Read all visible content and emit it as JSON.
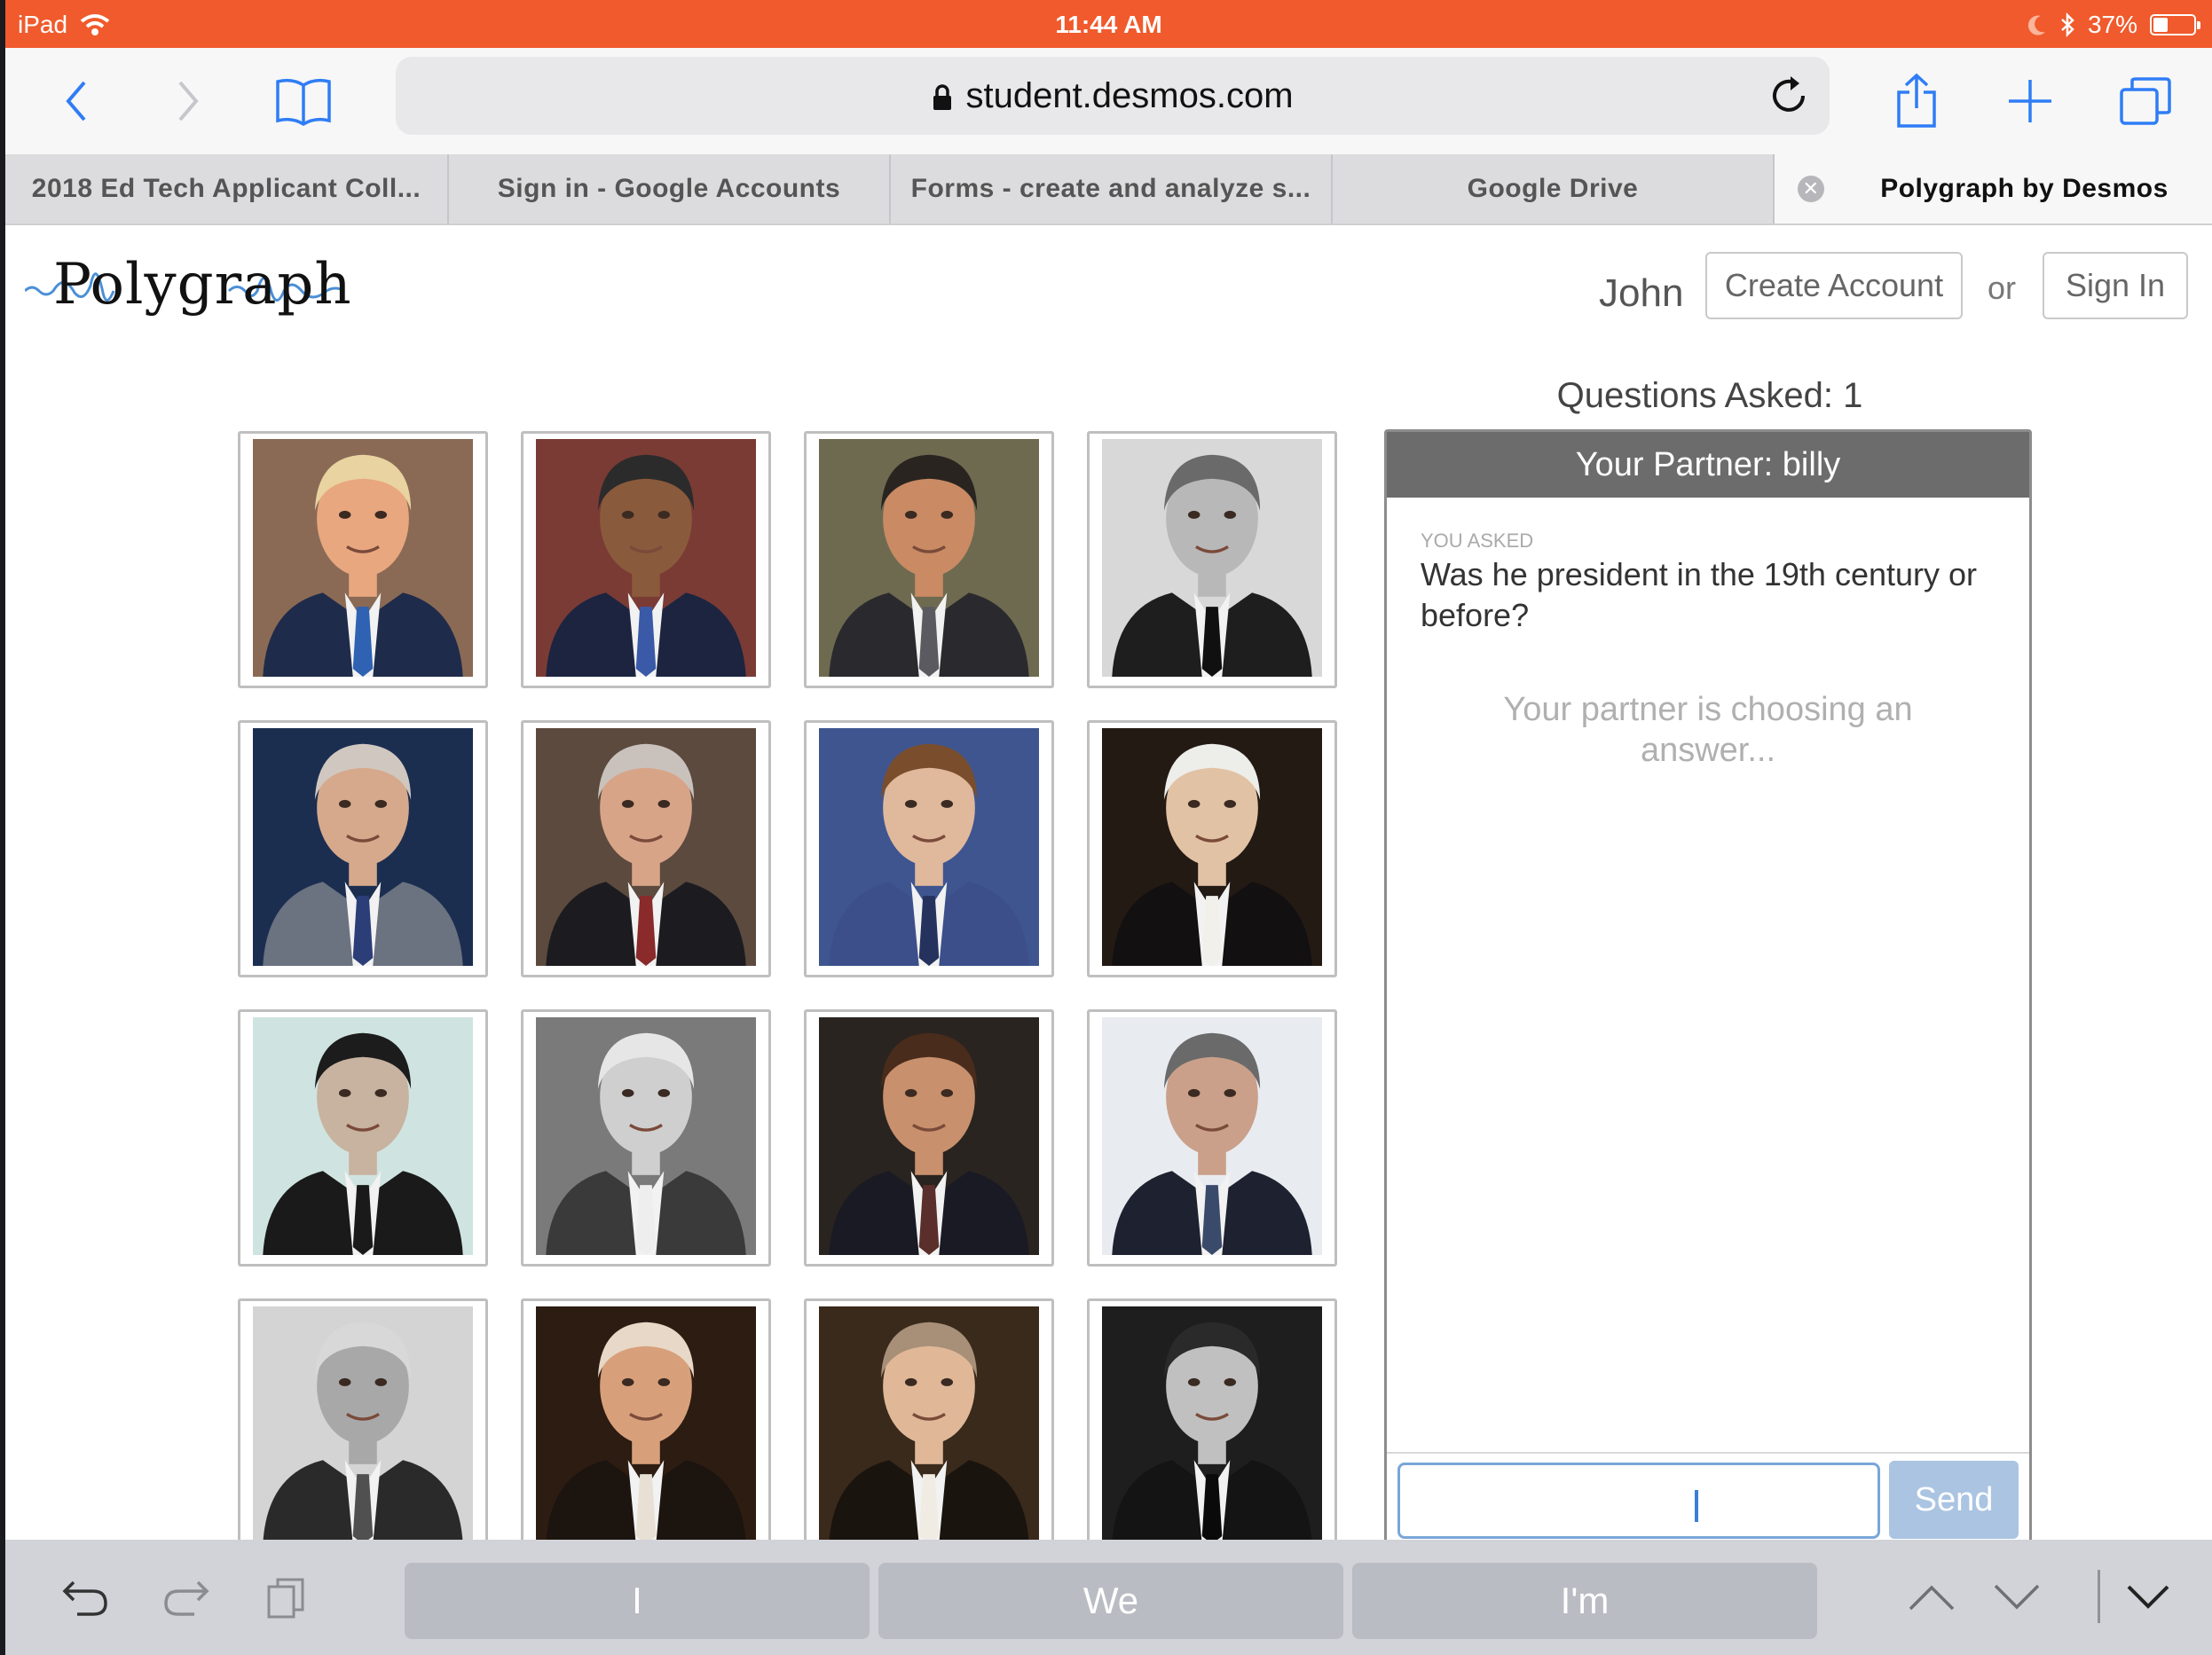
{
  "status_bar": {
    "device": "iPad",
    "time": "11:44 AM",
    "battery": "37%",
    "battery_level": 0.37
  },
  "browser": {
    "url": "student.desmos.com",
    "tabs": [
      {
        "title": "2018 Ed Tech Applicant Coll...",
        "active": false
      },
      {
        "title": "Sign in - Google Accounts",
        "active": false
      },
      {
        "title": "Forms - create and analyze s...",
        "active": false
      },
      {
        "title": "Google Drive",
        "active": false
      },
      {
        "title": "Polygraph by Desmos",
        "active": true
      }
    ]
  },
  "header": {
    "logo": "Polygraph",
    "user_name": "John",
    "create_account_label": "Create Account",
    "or_label": "or",
    "sign_in_label": "Sign In"
  },
  "game": {
    "questions_asked": "Questions Asked: 1",
    "partner_header": "Your Partner: billy",
    "you_asked_label": "YOU ASKED",
    "question": "Was he president in the 19th century or before?",
    "waiting": "Your partner is choosing an answer...",
    "input_value": "",
    "send_label": "Send",
    "cards": [
      {
        "name": "portrait-1",
        "bg": "#8a6a55",
        "skin": "#e8a77f",
        "hair": "#e9d3a0",
        "suit": "#1f2b4a",
        "tie": "#2f62b2"
      },
      {
        "name": "portrait-2",
        "bg": "#7a3b35",
        "skin": "#8a5a3c",
        "hair": "#2b2b2b",
        "suit": "#1c2440",
        "tie": "#3a5aa8"
      },
      {
        "name": "portrait-3",
        "bg": "#6e6a50",
        "skin": "#c98a64",
        "hair": "#2a2420",
        "suit": "#2a2a2e",
        "tie": "#5a5a60"
      },
      {
        "name": "portrait-4",
        "bg": "#d8d8d8",
        "skin": "#b8b8b8",
        "hair": "#6a6a6a",
        "suit": "#1e1e1e",
        "tie": "#101010"
      },
      {
        "name": "portrait-5",
        "bg": "#1c2e50",
        "skin": "#d6a98c",
        "hair": "#d0c8c0",
        "suit": "#6b7280",
        "tie": "#2c3e78"
      },
      {
        "name": "portrait-6",
        "bg": "#5c4a3e",
        "skin": "#d8a488",
        "hair": "#c9c2bc",
        "suit": "#1c1c20",
        "tie": "#8a2a2a"
      },
      {
        "name": "portrait-7",
        "bg": "#3e5590",
        "skin": "#e0b89c",
        "hair": "#7a4e2c",
        "suit": "#3c4f8a",
        "tie": "#26325e"
      },
      {
        "name": "portrait-8",
        "bg": "#231a14",
        "skin": "#e2c2a4",
        "hair": "#ededea",
        "suit": "#121010",
        "tie": "#f2f0ea"
      },
      {
        "name": "portrait-9",
        "bg": "#cfe4e0",
        "skin": "#c8b2a0",
        "hair": "#1c1c1c",
        "suit": "#1a1a1a",
        "tie": "#1a1a1a"
      },
      {
        "name": "portrait-10",
        "bg": "#7a7a7a",
        "skin": "#cfcfcf",
        "hair": "#e6e6e6",
        "suit": "#3a3a3a",
        "tie": "#eeeeee"
      },
      {
        "name": "portrait-11",
        "bg": "#2a2420",
        "skin": "#c8906c",
        "hair": "#4a2c1c",
        "suit": "#1a1a24",
        "tie": "#5a2e2a"
      },
      {
        "name": "portrait-12",
        "bg": "#e8ecf0",
        "skin": "#caa08a",
        "hair": "#6a6a6a",
        "suit": "#1e2230",
        "tie": "#3a4a6a"
      },
      {
        "name": "portrait-13",
        "bg": "#d4d4d4",
        "skin": "#a8a8a8",
        "hair": "#d8d8d8",
        "suit": "#2a2a2a",
        "tie": "#505050"
      },
      {
        "name": "portrait-14",
        "bg": "#2c1c12",
        "skin": "#d8a07a",
        "hair": "#e8d8c8",
        "suit": "#1c140e",
        "tie": "#e8e0d4"
      },
      {
        "name": "portrait-15",
        "bg": "#3a2a1c",
        "skin": "#e0b898",
        "hair": "#a89078",
        "suit": "#1a140e",
        "tie": "#f0ece4"
      },
      {
        "name": "portrait-16",
        "bg": "#1e1e1e",
        "skin": "#c0c0c0",
        "hair": "#2a2a2a",
        "suit": "#141414",
        "tie": "#0a0a0a"
      }
    ]
  },
  "keyboard_bar": {
    "suggestions": [
      "I",
      "We",
      "I'm"
    ]
  },
  "colors": {
    "status_bar": "#f05a2c",
    "accent_blue": "#3b7ed6",
    "chat_header": "#6c6c6c",
    "send_disabled": "#aac4e2"
  }
}
